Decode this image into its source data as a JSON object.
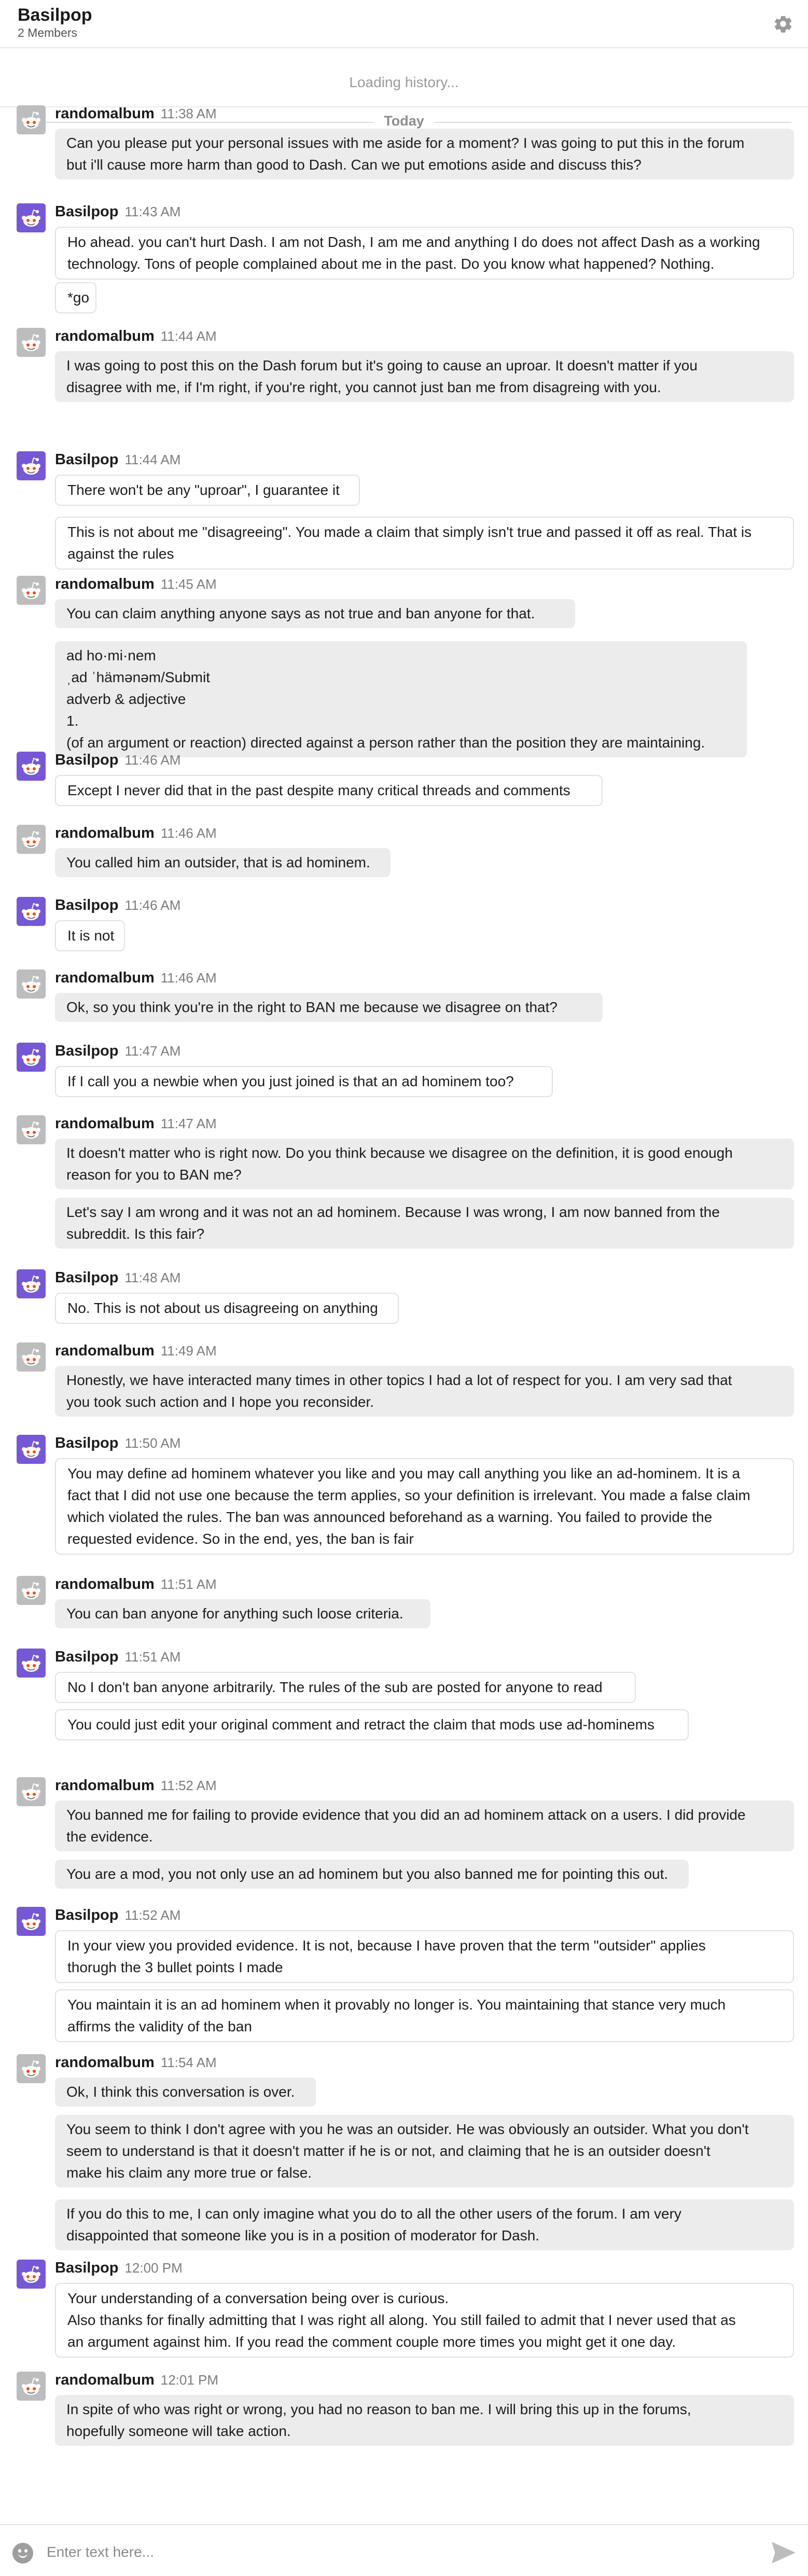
{
  "header": {
    "title": "Basilpop",
    "members": "2 Members"
  },
  "history": {
    "loading": "Loading history..."
  },
  "divider": {
    "label": "Today"
  },
  "composer": {
    "placeholder": "Enter text here..."
  },
  "groups": [
    {
      "author": "randomalbum",
      "time": "11:38 AM",
      "messages": [
        [
          "Can you please put your personal issues with me aside for a moment? I was going to put this in the forum",
          "but i'll cause more harm than good to Dash. Can we put emotions aside and discuss this?"
        ]
      ]
    },
    {
      "author": "Basilpop",
      "time": "11:43 AM",
      "messages": [
        [
          "Ho ahead. you can't hurt Dash. I am not Dash, I am me and anything I do does not affect Dash as a working",
          "technology. Tons of people complained about me in the past. Do you know what happened? Nothing."
        ],
        [
          "*go"
        ]
      ]
    },
    {
      "author": "randomalbum",
      "time": "11:44 AM",
      "messages": [
        [
          "I was going to post this on the Dash forum but it's going to cause an uproar. It doesn't matter if you",
          "disagree with me, if I'm right, if you're right, you cannot just ban me from disagreing with you."
        ]
      ]
    },
    {
      "author": "Basilpop",
      "time": "11:44 AM",
      "messages": [
        [
          "There won't be any \"uproar\", I guarantee it"
        ],
        [
          "This is not about me \"disagreeing\". You made a claim that simply isn't true and passed it off as real. That is",
          "against the rules"
        ]
      ]
    },
    {
      "author": "randomalbum",
      "time": "11:45 AM",
      "messages": [
        [
          "You can claim anything anyone says as not true and ban anyone for that."
        ],
        [
          "ad ho·mi·nem",
          "ˌad ˈhämənəm/Submit",
          "adverb & adjective",
          "1.",
          "(of an argument or reaction) directed against a person rather than the position they are maintaining."
        ]
      ]
    },
    {
      "author": "Basilpop",
      "time": "11:46 AM",
      "messages": [
        [
          "Except I never did that in the past despite many critical threads and comments"
        ]
      ]
    },
    {
      "author": "randomalbum",
      "time": "11:46 AM",
      "messages": [
        [
          "You called him an outsider, that is ad hominem."
        ]
      ]
    },
    {
      "author": "Basilpop",
      "time": "11:46 AM",
      "messages": [
        [
          "It is not"
        ]
      ]
    },
    {
      "author": "randomalbum",
      "time": "11:46 AM",
      "messages": [
        [
          "Ok, so you think you're in the right to BAN me because we disagree on that?"
        ]
      ]
    },
    {
      "author": "Basilpop",
      "time": "11:47 AM",
      "messages": [
        [
          "If I call you a newbie when you just joined is that an ad hominem too?"
        ]
      ]
    },
    {
      "author": "randomalbum",
      "time": "11:47 AM",
      "messages": [
        [
          "It doesn't matter who is right now. Do you think because we disagree on the definition, it is good enough",
          "reason for you to BAN me?"
        ],
        [
          "Let's say I am wrong and it was not an ad hominem. Because I was wrong, I am now banned from the",
          "subreddit. Is this fair?"
        ]
      ]
    },
    {
      "author": "Basilpop",
      "time": "11:48 AM",
      "messages": [
        [
          "No. This is not about us disagreeing on anything"
        ]
      ]
    },
    {
      "author": "randomalbum",
      "time": "11:49 AM",
      "messages": [
        [
          "Honestly, we have interacted many times in other topics I had a lot of respect for you. I am very sad that",
          "you took such action and I hope you reconsider."
        ]
      ]
    },
    {
      "author": "Basilpop",
      "time": "11:50 AM",
      "messages": [
        [
          "You may define ad hominem whatever you like and you may call anything you like an ad-hominem. It is a",
          "fact that I did not use one because the term applies, so your definition is irrelevant. You made a false claim",
          "which violated the rules. The ban was announced beforehand as a warning. You failed to provide the",
          "requested evidence. So in the end, yes, the ban is fair"
        ]
      ]
    },
    {
      "author": "randomalbum",
      "time": "11:51 AM",
      "messages": [
        [
          "You can ban anyone for anything such loose criteria."
        ]
      ]
    },
    {
      "author": "Basilpop",
      "time": "11:51 AM",
      "messages": [
        [
          "No I don't ban anyone arbitrarily. The rules of the sub are posted for anyone to read"
        ],
        [
          "You could just edit your original comment and retract the claim that mods use ad-hominems"
        ]
      ]
    },
    {
      "author": "randomalbum",
      "time": "11:52 AM",
      "messages": [
        [
          "You banned me for failing to provide evidence that you did an ad hominem attack on a users. I did provide",
          "the evidence."
        ],
        [
          "You are a mod, you not only use an ad hominem but you also banned me for pointing this out."
        ]
      ]
    },
    {
      "author": "Basilpop",
      "time": "11:52 AM",
      "messages": [
        [
          "In your view you provided evidence. It is not, because I have proven that the term \"outsider\" applies",
          "thorugh the 3 bullet points I made"
        ],
        [
          "You maintain it is an ad hominem when it provably no longer is. You maintaining that stance very much",
          "affirms the validity of the ban"
        ]
      ]
    },
    {
      "author": "randomalbum",
      "time": "11:54 AM",
      "messages": [
        [
          "Ok, I think this conversation is over."
        ],
        [
          "You seem to think I don't agree with you he was an outsider. He was obviously an outsider. What you don't",
          "seem to understand is that it doesn't matter if he is or not, and claiming that he is an outsider doesn't",
          "make his claim any more true or false."
        ],
        [
          "If you do this to me, I can only imagine what you do to all the other users of the forum. I am very",
          "disappointed that someone like you is in a position of moderator for Dash."
        ]
      ]
    },
    {
      "author": "Basilpop",
      "time": "12:00 PM",
      "messages": [
        [
          "Your understanding of a conversation being over is curious.",
          "Also thanks for finally admitting that I was right all along. You still failed to admit that I never used that as",
          "an argument against him. If you read the comment couple more times you might get it one day."
        ]
      ]
    },
    {
      "author": "randomalbum",
      "time": "12:01 PM",
      "messages": [
        [
          "In spite of who was right or wrong, you had no reason to ban me. I will bring this up in the forums,",
          "hopefully someone will take action."
        ]
      ]
    }
  ]
}
